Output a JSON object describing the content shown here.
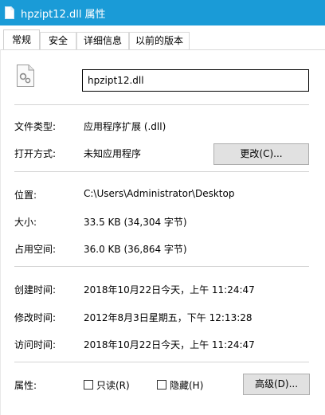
{
  "window": {
    "title": "hpzipt12.dll 属性"
  },
  "tabs": [
    {
      "label": "常规"
    },
    {
      "label": "安全"
    },
    {
      "label": "详细信息"
    },
    {
      "label": "以前的版本"
    }
  ],
  "general": {
    "file_name": "hpzipt12.dll",
    "file_type_label": "文件类型:",
    "file_type_value": "应用程序扩展 (.dll)",
    "open_with_label": "打开方式:",
    "open_with_value": "未知应用程序",
    "change_button": "更改(C)...",
    "location_label": "位置:",
    "location_value": "C:\\Users\\Administrator\\Desktop",
    "size_label": "大小:",
    "size_value": "33.5 KB (34,304 字节)",
    "size_on_disk_label": "占用空间:",
    "size_on_disk_value": "36.0 KB (36,864 字节)",
    "created_label": "创建时间:",
    "created_value": "2018年10月22日今天，上午 11:24:47",
    "modified_label": "修改时间:",
    "modified_value": "2012年8月3日星期五，下午 12:13:28",
    "accessed_label": "访问时间:",
    "accessed_value": "2018年10月22日今天，上午 11:24:47",
    "attributes_label": "属性:",
    "readonly_label": "只读(R)",
    "hidden_label": "隐藏(H)",
    "advanced_button": "高级(D)..."
  }
}
